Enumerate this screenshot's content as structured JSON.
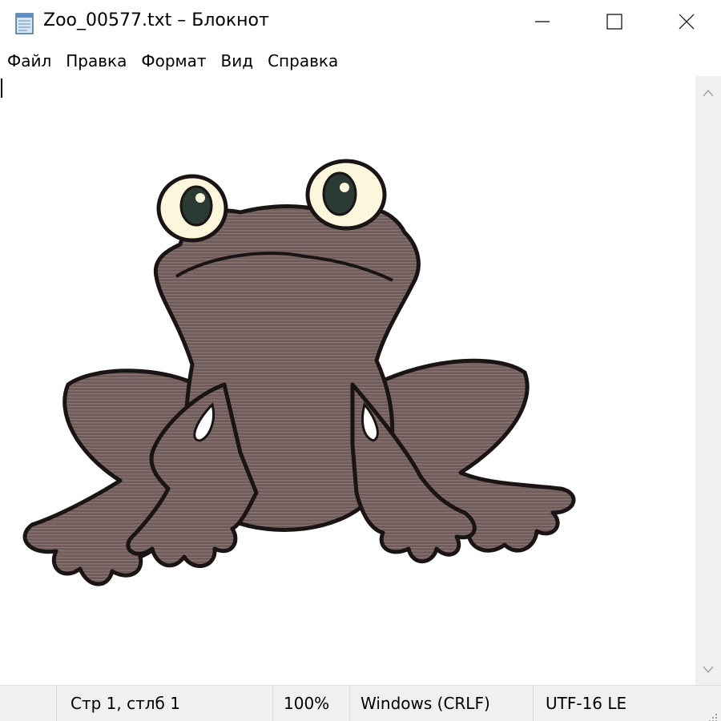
{
  "titlebar": {
    "title": "Zoo_00577.txt – Блокнот",
    "app_icon": "notepad-icon",
    "minimize_icon": "minimize-icon",
    "maximize_icon": "maximize-icon",
    "close_icon": "close-icon"
  },
  "menu": {
    "items": [
      {
        "label": "Файл"
      },
      {
        "label": "Правка"
      },
      {
        "label": "Формат"
      },
      {
        "label": "Вид"
      },
      {
        "label": "Справка"
      }
    ]
  },
  "editor": {
    "content_description_icon": "frog-ascii-art"
  },
  "statusbar": {
    "position": "Стр 1, стлб 1",
    "zoom": "100%",
    "line_endings": "Windows (CRLF)",
    "encoding": "UTF-16 LE"
  },
  "colors": {
    "frog_body": "#6f5c5b",
    "frog_outline": "#1a1414",
    "eye_white": "#fbf6dc",
    "eye_iris": "#2c3a34",
    "statusbar_bg": "#f0f0f0",
    "scrollbar_bg": "#f0f0f0"
  }
}
